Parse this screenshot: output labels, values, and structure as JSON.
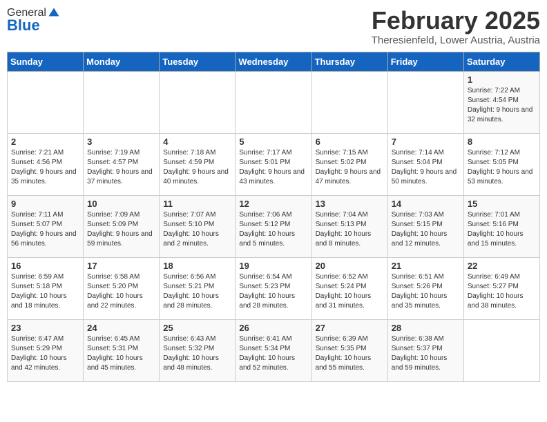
{
  "header": {
    "logo_general": "General",
    "logo_blue": "Blue",
    "title": "February 2025",
    "subtitle": "Theresienfeld, Lower Austria, Austria"
  },
  "weekdays": [
    "Sunday",
    "Monday",
    "Tuesday",
    "Wednesday",
    "Thursday",
    "Friday",
    "Saturday"
  ],
  "weeks": [
    [
      {
        "day": "",
        "info": ""
      },
      {
        "day": "",
        "info": ""
      },
      {
        "day": "",
        "info": ""
      },
      {
        "day": "",
        "info": ""
      },
      {
        "day": "",
        "info": ""
      },
      {
        "day": "",
        "info": ""
      },
      {
        "day": "1",
        "info": "Sunrise: 7:22 AM\nSunset: 4:54 PM\nDaylight: 9 hours and 32 minutes."
      }
    ],
    [
      {
        "day": "2",
        "info": "Sunrise: 7:21 AM\nSunset: 4:56 PM\nDaylight: 9 hours and 35 minutes."
      },
      {
        "day": "3",
        "info": "Sunrise: 7:19 AM\nSunset: 4:57 PM\nDaylight: 9 hours and 37 minutes."
      },
      {
        "day": "4",
        "info": "Sunrise: 7:18 AM\nSunset: 4:59 PM\nDaylight: 9 hours and 40 minutes."
      },
      {
        "day": "5",
        "info": "Sunrise: 7:17 AM\nSunset: 5:01 PM\nDaylight: 9 hours and 43 minutes."
      },
      {
        "day": "6",
        "info": "Sunrise: 7:15 AM\nSunset: 5:02 PM\nDaylight: 9 hours and 47 minutes."
      },
      {
        "day": "7",
        "info": "Sunrise: 7:14 AM\nSunset: 5:04 PM\nDaylight: 9 hours and 50 minutes."
      },
      {
        "day": "8",
        "info": "Sunrise: 7:12 AM\nSunset: 5:05 PM\nDaylight: 9 hours and 53 minutes."
      }
    ],
    [
      {
        "day": "9",
        "info": "Sunrise: 7:11 AM\nSunset: 5:07 PM\nDaylight: 9 hours and 56 minutes."
      },
      {
        "day": "10",
        "info": "Sunrise: 7:09 AM\nSunset: 5:09 PM\nDaylight: 9 hours and 59 minutes."
      },
      {
        "day": "11",
        "info": "Sunrise: 7:07 AM\nSunset: 5:10 PM\nDaylight: 10 hours and 2 minutes."
      },
      {
        "day": "12",
        "info": "Sunrise: 7:06 AM\nSunset: 5:12 PM\nDaylight: 10 hours and 5 minutes."
      },
      {
        "day": "13",
        "info": "Sunrise: 7:04 AM\nSunset: 5:13 PM\nDaylight: 10 hours and 8 minutes."
      },
      {
        "day": "14",
        "info": "Sunrise: 7:03 AM\nSunset: 5:15 PM\nDaylight: 10 hours and 12 minutes."
      },
      {
        "day": "15",
        "info": "Sunrise: 7:01 AM\nSunset: 5:16 PM\nDaylight: 10 hours and 15 minutes."
      }
    ],
    [
      {
        "day": "16",
        "info": "Sunrise: 6:59 AM\nSunset: 5:18 PM\nDaylight: 10 hours and 18 minutes."
      },
      {
        "day": "17",
        "info": "Sunrise: 6:58 AM\nSunset: 5:20 PM\nDaylight: 10 hours and 22 minutes."
      },
      {
        "day": "18",
        "info": "Sunrise: 6:56 AM\nSunset: 5:21 PM\nDaylight: 10 hours and 28 minutes."
      },
      {
        "day": "19",
        "info": "Sunrise: 6:54 AM\nSunset: 5:23 PM\nDaylight: 10 hours and 28 minutes."
      },
      {
        "day": "20",
        "info": "Sunrise: 6:52 AM\nSunset: 5:24 PM\nDaylight: 10 hours and 31 minutes."
      },
      {
        "day": "21",
        "info": "Sunrise: 6:51 AM\nSunset: 5:26 PM\nDaylight: 10 hours and 35 minutes."
      },
      {
        "day": "22",
        "info": "Sunrise: 6:49 AM\nSunset: 5:27 PM\nDaylight: 10 hours and 38 minutes."
      }
    ],
    [
      {
        "day": "23",
        "info": "Sunrise: 6:47 AM\nSunset: 5:29 PM\nDaylight: 10 hours and 42 minutes."
      },
      {
        "day": "24",
        "info": "Sunrise: 6:45 AM\nSunset: 5:31 PM\nDaylight: 10 hours and 45 minutes."
      },
      {
        "day": "25",
        "info": "Sunrise: 6:43 AM\nSunset: 5:32 PM\nDaylight: 10 hours and 48 minutes."
      },
      {
        "day": "26",
        "info": "Sunrise: 6:41 AM\nSunset: 5:34 PM\nDaylight: 10 hours and 52 minutes."
      },
      {
        "day": "27",
        "info": "Sunrise: 6:39 AM\nSunset: 5:35 PM\nDaylight: 10 hours and 55 minutes."
      },
      {
        "day": "28",
        "info": "Sunrise: 6:38 AM\nSunset: 5:37 PM\nDaylight: 10 hours and 59 minutes."
      },
      {
        "day": "",
        "info": ""
      }
    ]
  ]
}
